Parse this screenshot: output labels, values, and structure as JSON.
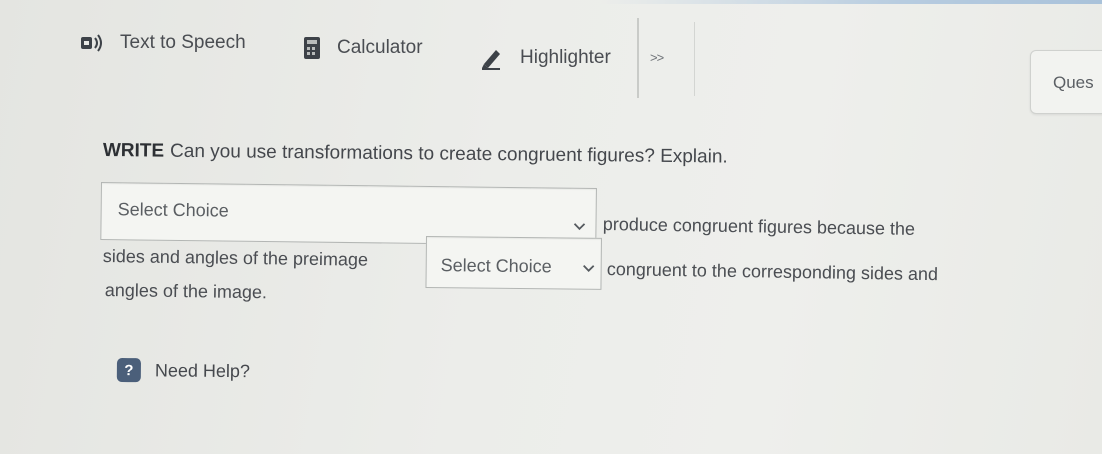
{
  "toolbar": {
    "text_to_speech": "Text to Speech",
    "calculator": "Calculator",
    "highlighter": "Highlighter",
    "more": ">>",
    "icons": {
      "text_to_speech": "speaker-icon",
      "calculator": "calculator-icon",
      "highlighter": "pencil-icon"
    }
  },
  "question_button": "Ques",
  "question": {
    "label": "WRITE",
    "text": "Can you use transformations to create congruent figures? Explain."
  },
  "answer": {
    "select_1": "Select Choice",
    "line_1": "produce congruent figures because the",
    "line_2": "sides and angles of the preimage",
    "select_2": "Select Choice",
    "line_3": "congruent to the corresponding sides and",
    "line_4": "angles of the image."
  },
  "help": {
    "label": "Need Help?",
    "icon_glyph": "?"
  },
  "colors": {
    "help_icon": "#4b5f7a",
    "background": "#ecedea"
  }
}
